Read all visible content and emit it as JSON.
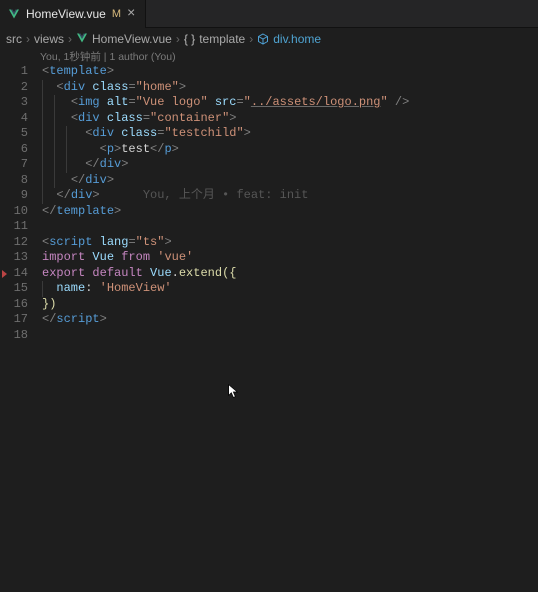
{
  "tab": {
    "filename": "HomeView.vue",
    "modified_marker": "M"
  },
  "breadcrumbs": {
    "seg1": "src",
    "seg2": "views",
    "seg3": "HomeView.vue",
    "seg4": "template",
    "seg5": "div.home"
  },
  "gitlens_summary": "You, 1秒钟前 | 1 author (You)",
  "code": {
    "l1": {
      "t1": "<",
      "tag": "template",
      "t2": ">"
    },
    "l2": {
      "t1": "<",
      "tag": "div",
      "sp": " ",
      "attr": "class",
      "eq": "=",
      "q1": "\"",
      "val": "home",
      "q2": "\"",
      "t2": ">"
    },
    "l3": {
      "t1": "<",
      "tag": "img",
      "sp": " ",
      "a1": "alt",
      "eq1": "=",
      "q1": "\"",
      "v1": "Vue logo",
      "q2": "\"",
      "sp2": " ",
      "a2": "src",
      "eq2": "=",
      "q3": "\"",
      "v2": "../assets/logo.png",
      "q4": "\"",
      "sp3": " ",
      "t2": "/>"
    },
    "l4": {
      "t1": "<",
      "tag": "div",
      "sp": " ",
      "attr": "class",
      "eq": "=",
      "q1": "\"",
      "val": "container",
      "q2": "\"",
      "t2": ">"
    },
    "l5": {
      "t1": "<",
      "tag": "div",
      "sp": " ",
      "attr": "class",
      "eq": "=",
      "q1": "\"",
      "val": "testchild",
      "q2": "\"",
      "t2": ">"
    },
    "l6": {
      "t1": "<",
      "tag": "p",
      "t2": ">",
      "txt": "test",
      "t3": "</",
      "tag2": "p",
      "t4": ">"
    },
    "l7": {
      "t1": "</",
      "tag": "div",
      "t2": ">"
    },
    "l8": {
      "t1": "</",
      "tag": "div",
      "t2": ">"
    },
    "l9": {
      "t1": "</",
      "tag": "div",
      "t2": ">",
      "blame": "      You, 上个月 • feat: init"
    },
    "l10": {
      "t1": "</",
      "tag": "template",
      "t2": ">"
    },
    "l12": {
      "t1": "<",
      "tag": "script",
      "sp": " ",
      "attr": "lang",
      "eq": "=",
      "q1": "\"",
      "val": "ts",
      "q2": "\"",
      "t2": ">"
    },
    "l13": {
      "kw1": "import",
      "sp1": " ",
      "var": "Vue",
      "sp2": " ",
      "kw2": "from",
      "sp3": " ",
      "str": "'vue'"
    },
    "l14": {
      "kw1": "export",
      "sp1": " ",
      "kw2": "default",
      "sp2": " ",
      "var": "Vue",
      "dot": ".",
      "fn": "extend",
      "p1": "(",
      "p2": "{"
    },
    "l15": {
      "key": "name",
      "colon": ":",
      "sp": " ",
      "str": "'HomeView'"
    },
    "l16": {
      "p1": "}",
      "p2": ")"
    },
    "l17": {
      "t1": "</",
      "tag": "script",
      "t2": ">"
    }
  },
  "line_numbers": [
    "1",
    "2",
    "3",
    "4",
    "5",
    "6",
    "7",
    "8",
    "9",
    "10",
    "11",
    "12",
    "13",
    "14",
    "15",
    "16",
    "17",
    "18"
  ]
}
